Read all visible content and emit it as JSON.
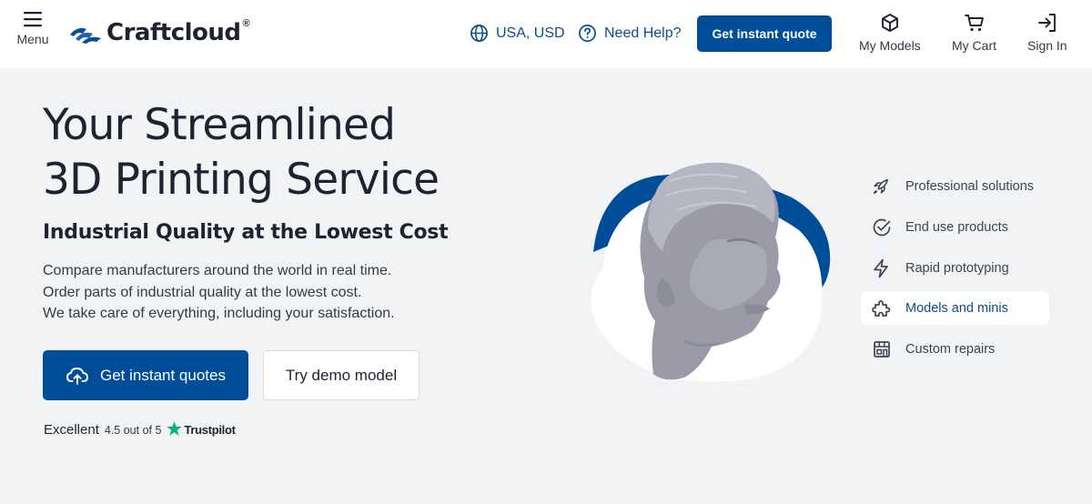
{
  "header": {
    "menu_label": "Menu",
    "logo_text": "Craftcloud",
    "logo_mark": "®",
    "locale": "USA, USD",
    "help": "Need Help?",
    "quote_button": "Get instant quote",
    "nav": [
      {
        "label": "My Models",
        "icon": "cube-icon"
      },
      {
        "label": "My Cart",
        "icon": "cart-icon"
      },
      {
        "label": "Sign In",
        "icon": "sign-in-icon"
      }
    ]
  },
  "hero": {
    "title_line1": "Your Streamlined",
    "title_line2": "3D Printing Service",
    "subtitle": "Industrial Quality at the Lowest Cost",
    "description": [
      "Compare manufacturers around the world in real time.",
      "Order parts of industrial quality at the lowest cost.",
      "We take care of everything, including your satisfaction."
    ],
    "primary_cta": "Get instant quotes",
    "secondary_cta": "Try demo model"
  },
  "rating": {
    "label": "Excellent",
    "score": "4.5 out of 5",
    "provider": "Trustpilot"
  },
  "categories": [
    {
      "label": "Professional solutions",
      "icon": "rocket-icon",
      "active": false
    },
    {
      "label": "End use products",
      "icon": "check-circle-icon",
      "active": false
    },
    {
      "label": "Rapid prototyping",
      "icon": "lightning-icon",
      "active": false
    },
    {
      "label": "Models and minis",
      "icon": "puzzle-icon",
      "active": true
    },
    {
      "label": "Custom repairs",
      "icon": "store-icon",
      "active": false
    }
  ],
  "colors": {
    "brand_blue": "#004d99",
    "link_blue": "#0a4d91",
    "trustpilot_green": "#00b67a",
    "background": "#f2f3f5"
  }
}
